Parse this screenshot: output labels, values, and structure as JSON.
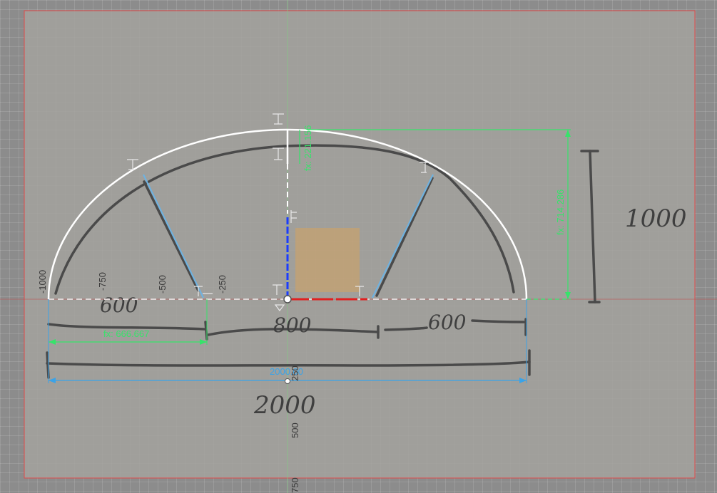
{
  "colors": {
    "canvas_bg": "#8c8c8c",
    "image_bg": "#a3a29d",
    "image_border": "#e04a4a",
    "arc": "#ffffff",
    "dimension_green": "#36e36a",
    "dimension_blue": "#3aa3e8",
    "axis_red": "#e02020",
    "axis_blue": "#1a3cff",
    "sketch_ink": "#4a4a4a",
    "origin_box": "#d4a35f"
  },
  "ruler": {
    "x_labels": [
      "-1000",
      "-750",
      "-500",
      "-250"
    ],
    "y_labels": [
      "250",
      "500",
      "750"
    ]
  },
  "dimensions": {
    "height": "fx: 714.286",
    "left_span": "fx: 666.667",
    "top_offset": "fx: 221.156",
    "total_width": "2000.00"
  },
  "handwriting": {
    "left_width": "600",
    "middle_width": "800",
    "right_width": "600",
    "total_width": "2000",
    "height": "1000"
  },
  "icons": {
    "constraint": "coincident-constraint-icon",
    "origin": "origin-point-icon"
  }
}
